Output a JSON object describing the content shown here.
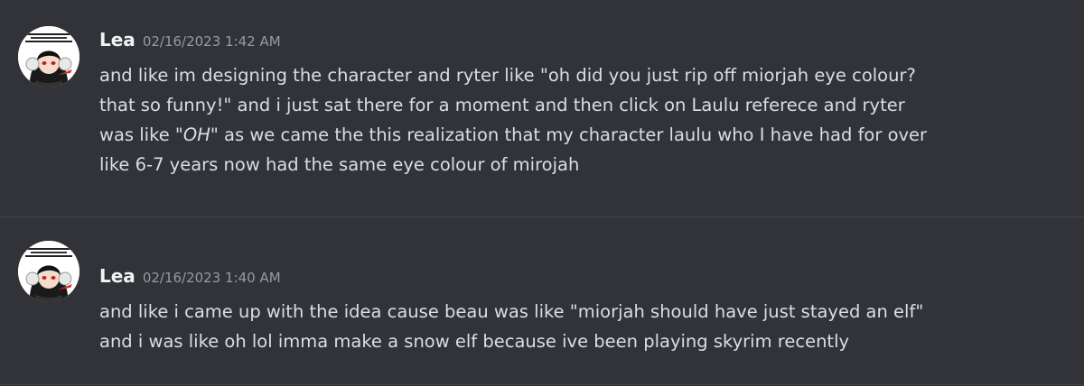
{
  "messages": [
    {
      "author": "Lea",
      "timestamp": "02/16/2023 1:42 AM",
      "lines": [
        "and like im designing the character and ryter like \"oh did you just rip off miorjah eye colour?",
        "that so funny!\" and i just sat there for a moment and then click on Laulu referece and ryter"
      ],
      "line3_prefix": "was like \"",
      "line3_emphasis": "OH",
      "line3_suffix": "\" as we came the this realization that my character laulu who I have had for over",
      "line4": "like 6-7 years now had the same eye colour of mirojah",
      "avatar_icon": "anime-character-avatar-icon"
    },
    {
      "author": "Lea",
      "timestamp": "02/16/2023 1:40 AM",
      "lines": [
        "and like i came up with the idea cause beau was like \"miorjah should have just stayed an elf\"",
        "and i was like oh lol imma make a snow elf because ive been playing skyrim recently"
      ],
      "avatar_icon": "anime-character-avatar-icon"
    }
  ],
  "colors": {
    "background": "#313338",
    "username": "#f2f3f5",
    "timestamp": "#949ba4",
    "message_text": "#dbdee1",
    "divider": "#3f4147"
  }
}
